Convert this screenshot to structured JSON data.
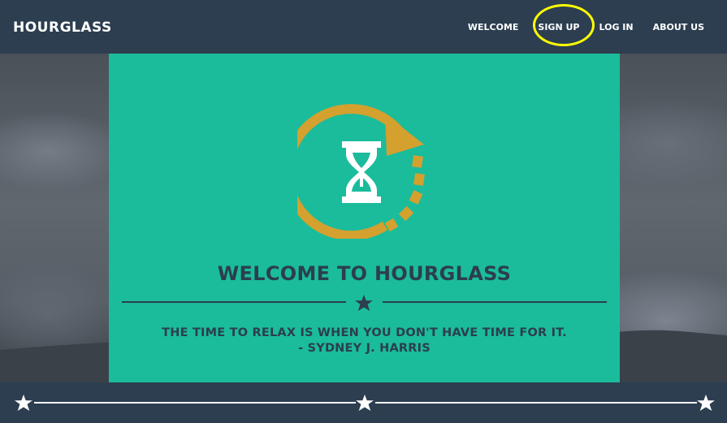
{
  "brand": "HOURGLASS",
  "nav": {
    "items": [
      {
        "label": "WELCOME"
      },
      {
        "label": "SIGN UP"
      },
      {
        "label": "LOG IN"
      },
      {
        "label": "ABOUT US"
      }
    ],
    "highlighted_item": "SIGN UP",
    "highlight_color": "#ffff00"
  },
  "hero": {
    "logo_icon": "hourglass-refresh-icon",
    "title": "WELCOME TO HOURGLASS",
    "divider_icon": "star-icon",
    "quote_line1": "THE TIME TO RELAX IS WHEN YOU DON'T HAVE TIME FOR IT.",
    "quote_line2": "- SYDNEY J. HARRIS"
  },
  "footer": {
    "divider_icon": "star-icon"
  },
  "colors": {
    "navbar": "#2c3e50",
    "accent": "#1abc9c",
    "logo_arrow": "#d4a02e",
    "text_dark": "#2c3e50",
    "text_light": "#ffffff"
  }
}
